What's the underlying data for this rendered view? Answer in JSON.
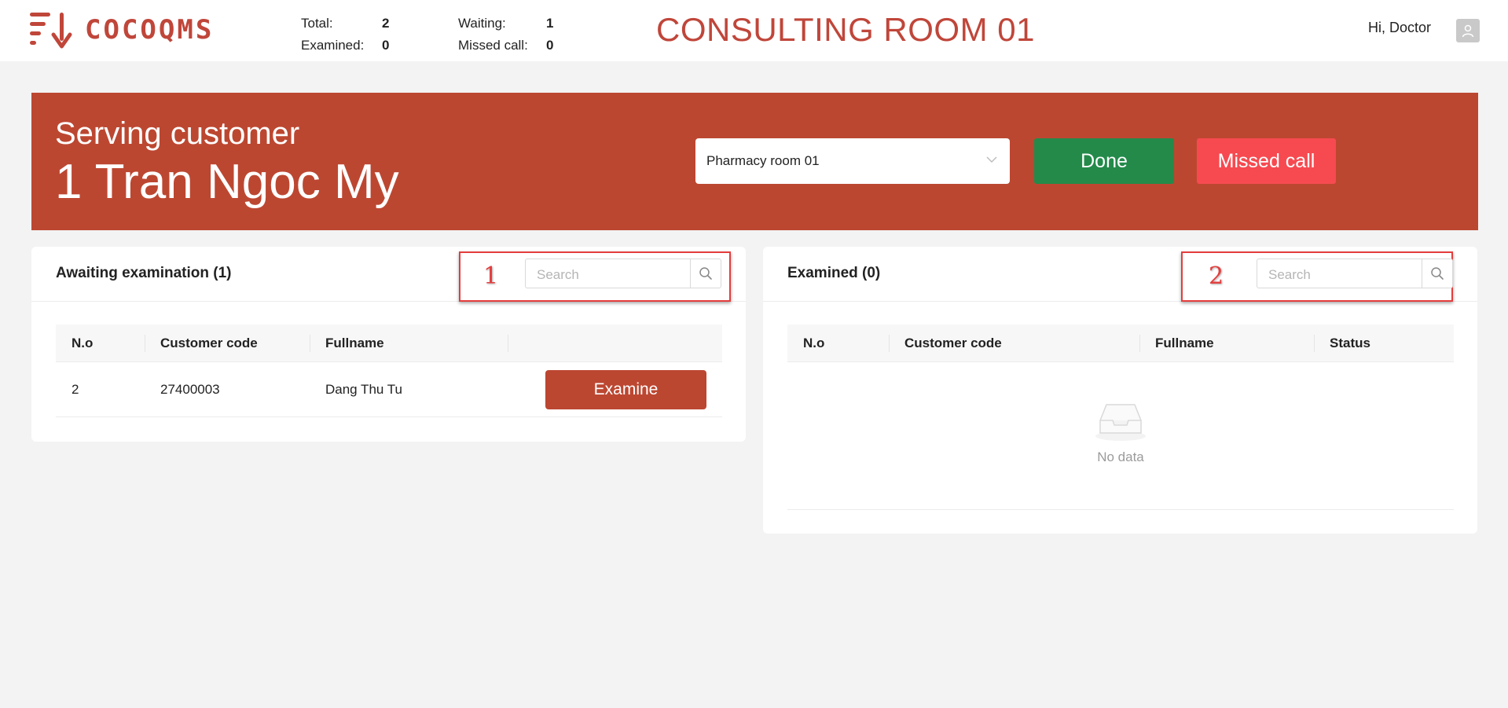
{
  "header": {
    "logo_text": "COCOQMS",
    "stats_left": [
      {
        "label": "Total:",
        "value": "2"
      },
      {
        "label": "Examined:",
        "value": "0"
      }
    ],
    "stats_right": [
      {
        "label": "Waiting:",
        "value": "1"
      },
      {
        "label": "Missed call:",
        "value": "0"
      }
    ],
    "room_title": "CONSULTING ROOM 01",
    "greeting": "Hi, Doctor"
  },
  "banner": {
    "label": "Serving customer",
    "customer": "1 Tran Ngoc My",
    "room_select": "Pharmacy room 01",
    "done_label": "Done",
    "missed_label": "Missed call"
  },
  "awaiting": {
    "title": "Awaiting examination (1)",
    "search_placeholder": "Search",
    "annotation": "1",
    "columns": [
      "N.o",
      "Customer code",
      "Fullname",
      ""
    ],
    "rows": [
      {
        "no": "2",
        "code": "27400003",
        "name": "Dang Thu Tu",
        "action": "Examine"
      }
    ]
  },
  "examined": {
    "title": "Examined (0)",
    "search_placeholder": "Search",
    "annotation": "2",
    "columns": [
      "N.o",
      "Customer code",
      "Fullname",
      "Status"
    ],
    "empty_text": "No data"
  },
  "colors": {
    "brand": "#c0463a",
    "banner": "#bc4731",
    "done": "#238a4a",
    "missed": "#f64a50",
    "annotation": "#e43d3d"
  }
}
